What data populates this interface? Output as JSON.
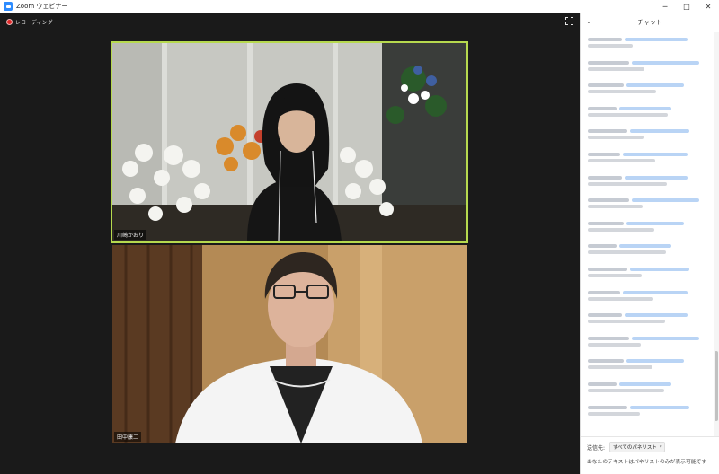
{
  "window": {
    "title": "Zoom ウェビナー",
    "controls": {
      "minimize": "─",
      "maximize": "□",
      "close": "✕"
    }
  },
  "recording": {
    "label": "レコーディング",
    "icon": "record-icon"
  },
  "toolbar": {
    "fullscreen_icon": "fullscreen-icon"
  },
  "participants": [
    {
      "name": "川崎かおり",
      "active_speaker": true
    },
    {
      "name": "田中康二",
      "active_speaker": false
    }
  ],
  "colors": {
    "active_speaker_border": "#b6d94e",
    "accent": "#2d8cff"
  },
  "chat": {
    "title": "チャット",
    "collapse_icon": "chevron-down-icon",
    "message_count": 17,
    "footer": {
      "send_label": "送信先:",
      "recipient": "すべてのパネリスト",
      "hint": "あなたのテキストはパネリストのみが表示可能です"
    }
  }
}
